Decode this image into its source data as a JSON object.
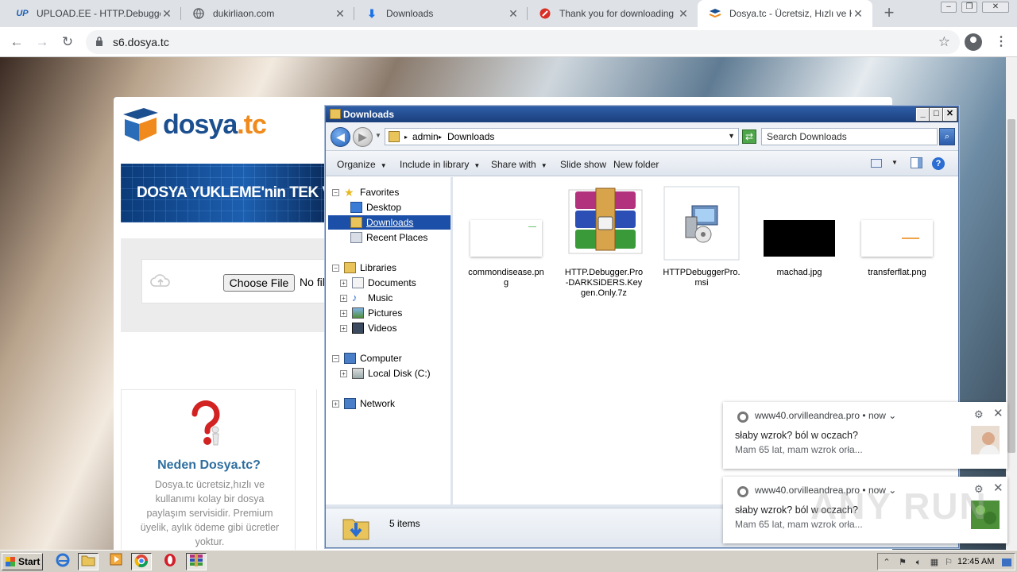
{
  "browser": {
    "tabs": [
      {
        "favicon": "UP",
        "title": "UPLOAD.EE - HTTP.Debugger.P",
        "active": false
      },
      {
        "favicon": "globe",
        "title": "dukirliaon.com",
        "active": false
      },
      {
        "favicon": "download",
        "title": "Downloads",
        "active": false
      },
      {
        "favicon": "red-circle",
        "title": "Thank you for downloading HTT",
        "active": false
      },
      {
        "favicon": "dosya",
        "title": "Dosya.tc - Ücretsiz, Hızlı ve Kola",
        "active": true
      }
    ],
    "url": "s6.dosya.tc"
  },
  "website": {
    "logo_main": "dosya",
    "logo_tld": ".tc",
    "banner_text": "DOSYA YUKLEME'nin TEK VE",
    "choose_file_label": "Choose File",
    "no_file_text": "No fil",
    "why_title": "Neden Dosya.tc?",
    "why_text": "Dosya.tc ücretsiz,hızlı ve kullanımı kolay bir dosya paylaşım servisidir. Premium üyelik, aylık ödeme gibi ücretler yoktur."
  },
  "explorer": {
    "title": "Downloads",
    "breadcrumb": [
      "admin",
      "Downloads"
    ],
    "search_placeholder": "Search Downloads",
    "commands": [
      "Organize",
      "Include in library",
      "Share with",
      "Slide show",
      "New folder"
    ],
    "nav": {
      "favorites": "Favorites",
      "desktop": "Desktop",
      "downloads": "Downloads",
      "recent": "Recent Places",
      "libraries": "Libraries",
      "documents": "Documents",
      "music": "Music",
      "pictures": "Pictures",
      "videos": "Videos",
      "computer": "Computer",
      "local_disk": "Local Disk (C:)",
      "network": "Network"
    },
    "files": [
      {
        "name": "commondisease.png",
        "icon": "png-thumbnail"
      },
      {
        "name": "HTTP.Debugger.Pro-DARKSiDERS.Keygen.Only.7z",
        "icon": "winrar-archive-icon"
      },
      {
        "name": "HTTPDebuggerPro.msi",
        "icon": "msi-installer-icon"
      },
      {
        "name": "machad.jpg",
        "icon": "black-image-thumbnail"
      },
      {
        "name": "transferflat.png",
        "icon": "png-thumbnail"
      }
    ],
    "item_count": "5 items"
  },
  "notifications": [
    {
      "source": "www40.orvilleandrea.pro",
      "time": "now",
      "title": "słaby wzrok? ból w oczach?",
      "body": "Mam 65 lat, mam wzrok orła..."
    },
    {
      "source": "www40.orvilleandrea.pro",
      "time": "now",
      "title": "słaby wzrok? ból w oczach?",
      "body": "Mam 65 lat, mam wzrok orła..."
    }
  ],
  "watermark": "ANY RUN",
  "taskbar": {
    "start_label": "Start",
    "clock": "12:45 AM"
  },
  "colors": {
    "explorer_titlebar": "#1a3f7c",
    "selection": "#1b4fa8",
    "dosya_blue": "#1c4f8f",
    "dosya_orange": "#f08a1c",
    "why_title": "#2e6e9e"
  }
}
